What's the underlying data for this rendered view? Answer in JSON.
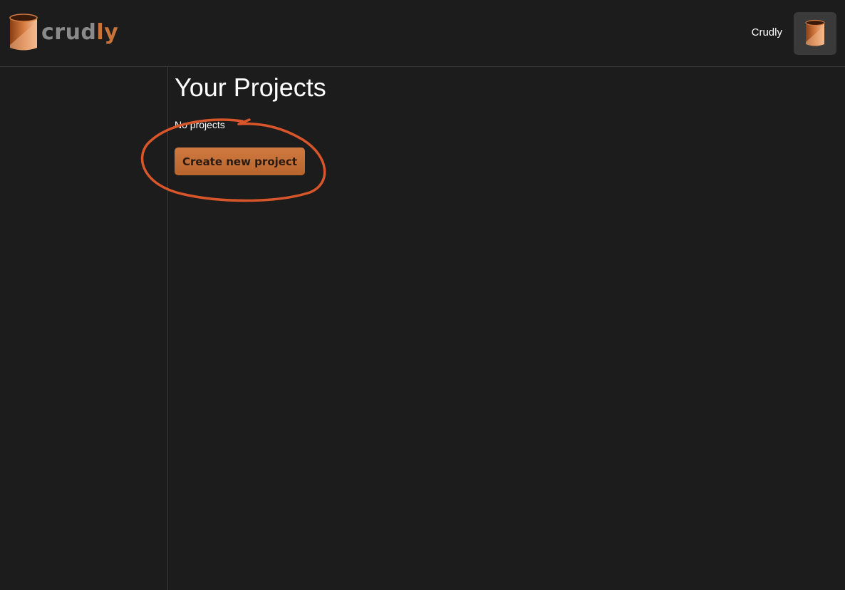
{
  "header": {
    "logo": {
      "text_part_a": "crud",
      "text_part_b": "ly",
      "icon": "cylinder-logo-icon"
    },
    "user_name": "Crudly",
    "avatar_icon": "cylinder-avatar-icon"
  },
  "main": {
    "title": "Your Projects",
    "empty_message": "No projects",
    "create_button_label": "Create new project"
  },
  "colors": {
    "background": "#1c1c1c",
    "accent": "#c8733a",
    "annotation": "#d9552a",
    "divider": "#3a3a3a",
    "avatar_bg": "#3a3a3a"
  },
  "annotation": {
    "shape": "hand-drawn-circle",
    "target": "create-new-project-button"
  }
}
